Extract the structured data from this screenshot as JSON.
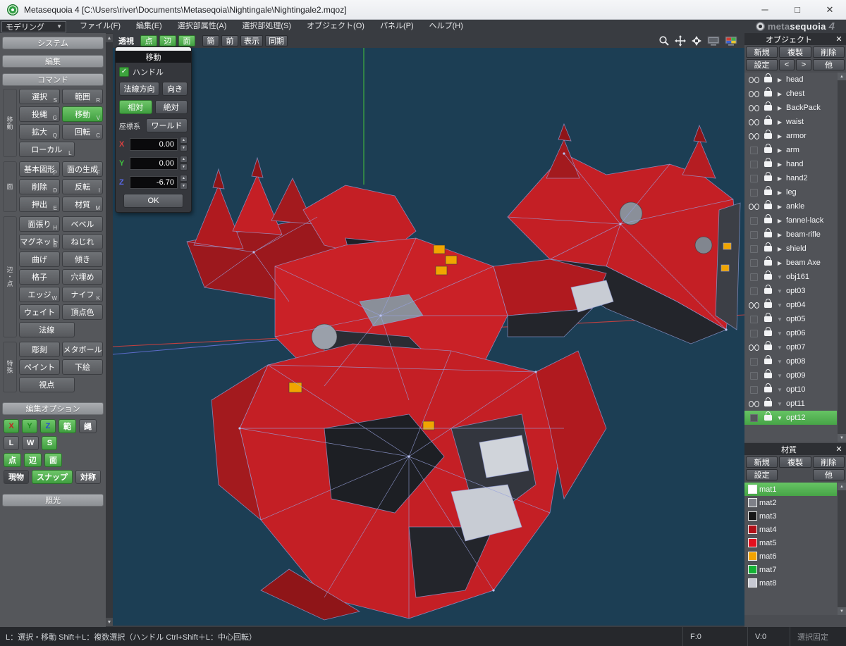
{
  "window": {
    "title": "Metasequoia 4 [C:\\Users\\river\\Documents\\Metaseqoia\\Nightingale\\Nightingale2.mqoz]",
    "minimize": "─",
    "maximize": "□",
    "close": "✕"
  },
  "menu_bar": {
    "mode_selector": "モデリング",
    "mode_caret": "▼",
    "items": [
      "ファイル(F)",
      "編集(E)",
      "選択部属性(A)",
      "選択部処理(S)",
      "オブジェクト(O)",
      "パネル(P)",
      "ヘルプ(H)"
    ],
    "logo": {
      "part1": "meta",
      "part2": "sequoia",
      "part3": "4"
    }
  },
  "toolbar": {
    "view_label": "透視",
    "toggles": [
      {
        "label": "点",
        "active": true
      },
      {
        "label": "辺",
        "active": true
      },
      {
        "label": "面",
        "active": true
      }
    ],
    "buttons": [
      "簡",
      "前",
      "表示",
      "同期"
    ],
    "right_icons": [
      "zoom-icon",
      "pan-icon",
      "rotate-icon",
      "dual-view-icon",
      "color-view-icon"
    ]
  },
  "sidebar": {
    "headers": {
      "system": "システム",
      "edit": "編集",
      "command": "コマンド",
      "edit_options": "編集オプション",
      "light": "照光"
    },
    "command_groups": [
      {
        "tab": "移動",
        "rows": [
          [
            {
              "label": "選択",
              "key": "S"
            },
            {
              "label": "範囲",
              "key": "R"
            }
          ],
          [
            {
              "label": "投縄",
              "key": "G"
            },
            {
              "label": "移動",
              "key": "V",
              "active": true
            }
          ],
          [
            {
              "label": "拡大",
              "key": "Q"
            },
            {
              "label": "回転",
              "key": "C"
            }
          ],
          [
            {
              "label": "ローカル",
              "key": "L"
            }
          ]
        ]
      },
      {
        "tab": "面",
        "rows": [
          [
            {
              "label": "基本図形",
              "key": "P"
            },
            {
              "label": "面の生成",
              "key": "F"
            }
          ],
          [
            {
              "label": "削除",
              "key": "D"
            },
            {
              "label": "反転",
              "key": "I"
            }
          ],
          [
            {
              "label": "押出",
              "key": "E"
            },
            {
              "label": "材質",
              "key": "M"
            }
          ]
        ]
      },
      {
        "tab": "辺・点",
        "rows": [
          [
            {
              "label": "面張り",
              "key": "H"
            },
            {
              "label": "ベベル",
              "key": ""
            }
          ],
          [
            {
              "label": "マグネット",
              "key": "B"
            },
            {
              "label": "ねじれ",
              "key": ""
            }
          ],
          [
            {
              "label": "曲げ",
              "key": ""
            },
            {
              "label": "傾き",
              "key": ""
            }
          ],
          [
            {
              "label": "格子",
              "key": ""
            },
            {
              "label": "穴埋め",
              "key": ""
            }
          ],
          [
            {
              "label": "エッジ",
              "key": "W"
            },
            {
              "label": "ナイフ",
              "key": "K"
            }
          ],
          [
            {
              "label": "ウェイト",
              "key": ""
            },
            {
              "label": "頂点色",
              "key": ""
            }
          ],
          [
            {
              "label": "法線",
              "key": ""
            }
          ]
        ]
      },
      {
        "tab": "特殊",
        "rows": [
          [
            {
              "label": "彫刻",
              "key": ""
            },
            {
              "label": "メタボール",
              "key": ""
            }
          ],
          [
            {
              "label": "ペイント",
              "key": ""
            },
            {
              "label": "下絵",
              "key": ""
            }
          ],
          [
            {
              "label": "視点",
              "key": ""
            }
          ]
        ]
      }
    ],
    "edit_options": {
      "rows": [
        [
          {
            "label": "X",
            "variant": "green",
            "letter_color": "#c42222"
          },
          {
            "label": "Y",
            "variant": "green",
            "letter_color": "#1e8a1e"
          },
          {
            "label": "Z",
            "variant": "green",
            "letter_color": "#2848d8"
          },
          {
            "label": "範",
            "variant": "green"
          },
          {
            "label": "縄",
            "variant": "gray"
          }
        ],
        [
          {
            "label": "L",
            "variant": "gray"
          },
          {
            "label": "W",
            "variant": "gray"
          },
          {
            "label": "S",
            "variant": "green"
          }
        ],
        [
          {
            "label": "点",
            "variant": "green"
          },
          {
            "label": "辺",
            "variant": "green"
          },
          {
            "label": "面",
            "variant": "green"
          }
        ],
        [
          {
            "label": "現物",
            "variant": "dark"
          },
          {
            "label": "スナップ",
            "variant": "green"
          },
          {
            "label": "対称",
            "variant": "gray"
          }
        ]
      ]
    }
  },
  "move_dialog": {
    "title": "移動",
    "handle": {
      "checked": true,
      "checkmark": "✓",
      "label": "ハンドル"
    },
    "normal_button": "法線方向",
    "direction_button": "向き",
    "relative_button": "相対",
    "absolute_button": "絶対",
    "coord_label": "座標系",
    "coord_value": "ワールド",
    "fields": [
      {
        "axis": "X",
        "value": "0.00",
        "color": "#d84040"
      },
      {
        "axis": "Y",
        "value": "0.00",
        "color": "#3fbf3f"
      },
      {
        "axis": "Z",
        "value": "-6.70",
        "color": "#5868e8"
      }
    ],
    "ok_label": "OK"
  },
  "viewport": {
    "background": "#1c3e54",
    "axis_x_color": "#c04040",
    "axis_y_color": "#3faf3f",
    "axis_z_color": "#5b6bc8",
    "wireframe_color": "#97a1dc",
    "model_colors": {
      "red": "#c41f25",
      "dark_red": "#8f1518",
      "shadow": "#23252b",
      "gray": "#8a8f99",
      "light_gray": "#d0d4da",
      "accent_orange": "#f0a500"
    }
  },
  "object_panel": {
    "title": "オブジェクト",
    "close": "✕",
    "actions": [
      "新規",
      "複製",
      "削除"
    ],
    "actions2": [
      "設定",
      "<",
      ">",
      "他"
    ],
    "items": [
      {
        "name": "head",
        "visible": true,
        "expand": "right"
      },
      {
        "name": "chest",
        "visible": true,
        "expand": "right"
      },
      {
        "name": "BackPack",
        "visible": true,
        "expand": "right"
      },
      {
        "name": "waist",
        "visible": true,
        "expand": "right"
      },
      {
        "name": "armor",
        "visible": true,
        "expand": "right"
      },
      {
        "name": "arm",
        "visible": false,
        "expand": "right"
      },
      {
        "name": "hand",
        "visible": false,
        "expand": "right"
      },
      {
        "name": "hand2",
        "visible": false,
        "expand": "right"
      },
      {
        "name": "leg",
        "visible": false,
        "expand": "right"
      },
      {
        "name": "ankle",
        "visible": true,
        "expand": "right"
      },
      {
        "name": "fannel-lack",
        "visible": false,
        "expand": "right"
      },
      {
        "name": "beam-rifle",
        "visible": false,
        "expand": "right"
      },
      {
        "name": "shield",
        "visible": false,
        "expand": "right"
      },
      {
        "name": "beam Axe",
        "visible": false,
        "expand": "right"
      },
      {
        "name": "obj161",
        "visible": false,
        "expand": "down"
      },
      {
        "name": "opt03",
        "visible": false,
        "expand": "down"
      },
      {
        "name": "opt04",
        "visible": true,
        "expand": "down"
      },
      {
        "name": "opt05",
        "visible": false,
        "expand": "down"
      },
      {
        "name": "opt06",
        "visible": false,
        "expand": "down"
      },
      {
        "name": "opt07",
        "visible": true,
        "expand": "down"
      },
      {
        "name": "opt08",
        "visible": false,
        "expand": "down"
      },
      {
        "name": "opt09",
        "visible": false,
        "expand": "down"
      },
      {
        "name": "opt10",
        "visible": false,
        "expand": "down"
      },
      {
        "name": "opt11",
        "visible": true,
        "expand": "down"
      },
      {
        "name": "opt12",
        "visible": false,
        "expand": "down",
        "selected": true
      }
    ]
  },
  "material_panel": {
    "title": "材質",
    "close": "✕",
    "actions": [
      "新規",
      "複製",
      "削除"
    ],
    "actions2": [
      "設定",
      "",
      "他"
    ],
    "items": [
      {
        "name": "mat1",
        "color": "#ffffff",
        "selected": true
      },
      {
        "name": "mat2",
        "color": "#7e8088"
      },
      {
        "name": "mat3",
        "color": "#161617"
      },
      {
        "name": "mat4",
        "color": "#b01018"
      },
      {
        "name": "mat5",
        "color": "#e5101e"
      },
      {
        "name": "mat6",
        "color": "#f2a300"
      },
      {
        "name": "mat7",
        "color": "#14b234"
      },
      {
        "name": "mat8",
        "color": "#c6c8d2"
      }
    ]
  },
  "status_bar": {
    "hint": "L：選択・移動  Shift＋L：複数選択（ハンドル  Ctrl+Shift＋L：中心回転）",
    "face_count": "F:0",
    "vertex_count": "V:0",
    "lock_label": "選択固定"
  }
}
